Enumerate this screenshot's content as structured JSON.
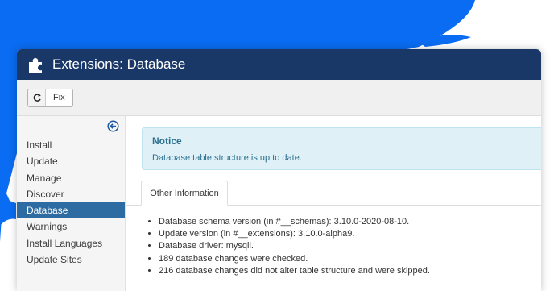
{
  "colors": {
    "splash": "#0a6cf2",
    "header_bg": "#1a3867",
    "active_item_bg": "#2d6ca2",
    "notice_bg": "#dff0f7",
    "notice_text": "#2a6f8f"
  },
  "header": {
    "title": "Extensions: Database",
    "icon": "puzzle-icon"
  },
  "toolbar": {
    "fix_label": "Fix",
    "fix_icon": "refresh-icon"
  },
  "sidebar": {
    "collapse_icon": "arrow-circle-left-icon",
    "items": [
      {
        "label": "Install"
      },
      {
        "label": "Update"
      },
      {
        "label": "Manage"
      },
      {
        "label": "Discover"
      },
      {
        "label": "Database"
      },
      {
        "label": "Warnings"
      },
      {
        "label": "Install Languages"
      },
      {
        "label": "Update Sites"
      }
    ],
    "active": "Database"
  },
  "notice": {
    "title": "Notice",
    "message": "Database table structure is up to date."
  },
  "tabs": [
    {
      "label": "Other Information"
    }
  ],
  "info": [
    "Database schema version (in #__schemas): 3.10.0-2020-08-10.",
    "Update version (in #__extensions): 3.10.0-alpha9.",
    "Database driver: mysqli.",
    "189 database changes were checked.",
    "216 database changes did not alter table structure and were skipped."
  ]
}
